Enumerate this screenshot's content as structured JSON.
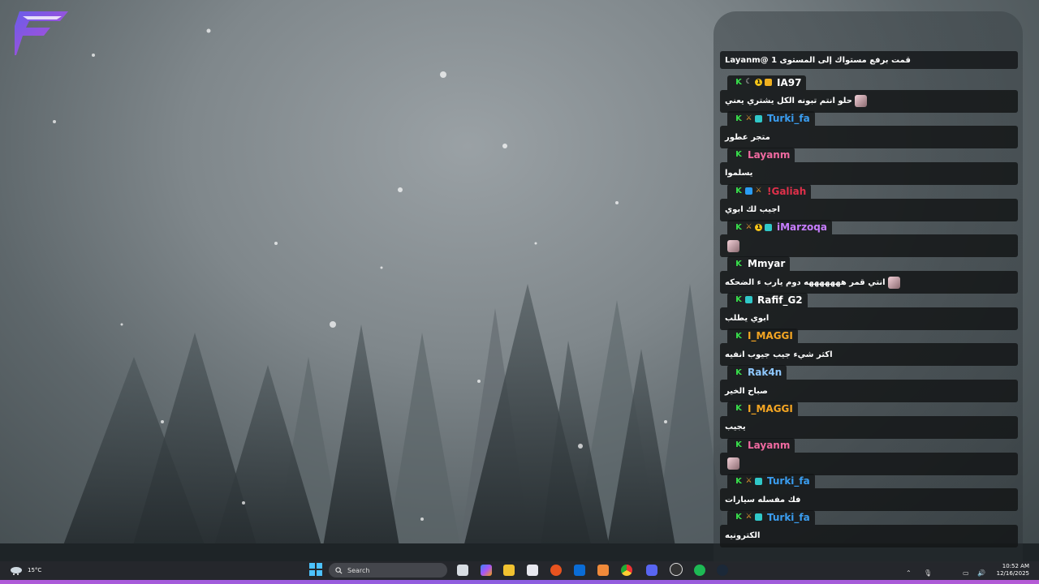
{
  "colors": {
    "chat_bg": "#141618",
    "taskbar": "#26282c",
    "accent": "#b05ad8"
  },
  "chat": {
    "top_message": "قمت برفع مستواك إلى المستوى 1 @Layanm",
    "entries": [
      {
        "user": "IA97",
        "color": "#ffffff",
        "badges": [
          "k",
          "moon",
          "one",
          "sub"
        ],
        "text": "حلو انتم تبونه الكل يشتري يعني",
        "emote": true
      },
      {
        "user": "Turki_fa",
        "color": "#3a9df0",
        "badges": [
          "k",
          "sword",
          "grid"
        ],
        "text": "متجر عطور",
        "emote": false
      },
      {
        "user": "Layanm",
        "color": "#f06aa0",
        "badges": [
          "k"
        ],
        "text": "يسلموا",
        "emote": false
      },
      {
        "user": "!Galiah",
        "color": "#e0304a",
        "badges": [
          "k",
          "blue",
          "sword"
        ],
        "text": "اجيب لك ابوي",
        "emote": false
      },
      {
        "user": "iMarzoqa",
        "color": "#c77dff",
        "badges": [
          "k",
          "sword",
          "one",
          "grid"
        ],
        "text": "",
        "emote": true
      },
      {
        "user": "Mmyar",
        "color": "#ffffff",
        "badges": [
          "k"
        ],
        "text": "انتي قمر هههههههه دوم يارب ء الضحكه",
        "emote": true
      },
      {
        "user": "Rafif_G2",
        "color": "#ffffff",
        "badges": [
          "k",
          "grid"
        ],
        "text": "ابوي يطلب",
        "emote": false
      },
      {
        "user": "I_MAGGI",
        "color": "#f5a623",
        "badges": [
          "k"
        ],
        "text": "اكثر شيء جيب جيوب انفيه",
        "emote": false
      },
      {
        "user": "Rak4n",
        "color": "#8fc8ff",
        "badges": [
          "k"
        ],
        "text": "صباح الخير",
        "emote": false
      },
      {
        "user": "I_MAGGI",
        "color": "#f5a623",
        "badges": [
          "k"
        ],
        "text": "يجيب",
        "emote": false
      },
      {
        "user": "Layanm",
        "color": "#f06aa0",
        "badges": [
          "k"
        ],
        "text": "",
        "emote": true
      },
      {
        "user": "Turki_fa",
        "color": "#3a9df0",
        "badges": [
          "k",
          "sword",
          "grid"
        ],
        "text": "فك مفسله سيارات",
        "emote": false
      },
      {
        "user": "Turki_fa",
        "color": "#3a9df0",
        "badges": [
          "k",
          "sword",
          "grid"
        ],
        "text": "الكترونيه",
        "emote": false
      }
    ]
  },
  "taskbar": {
    "temperature": "15°C",
    "weather_icon": "cloud-snow-icon",
    "search_placeholder": "Search",
    "time": "10:52 AM",
    "date": "12/16/2025"
  }
}
